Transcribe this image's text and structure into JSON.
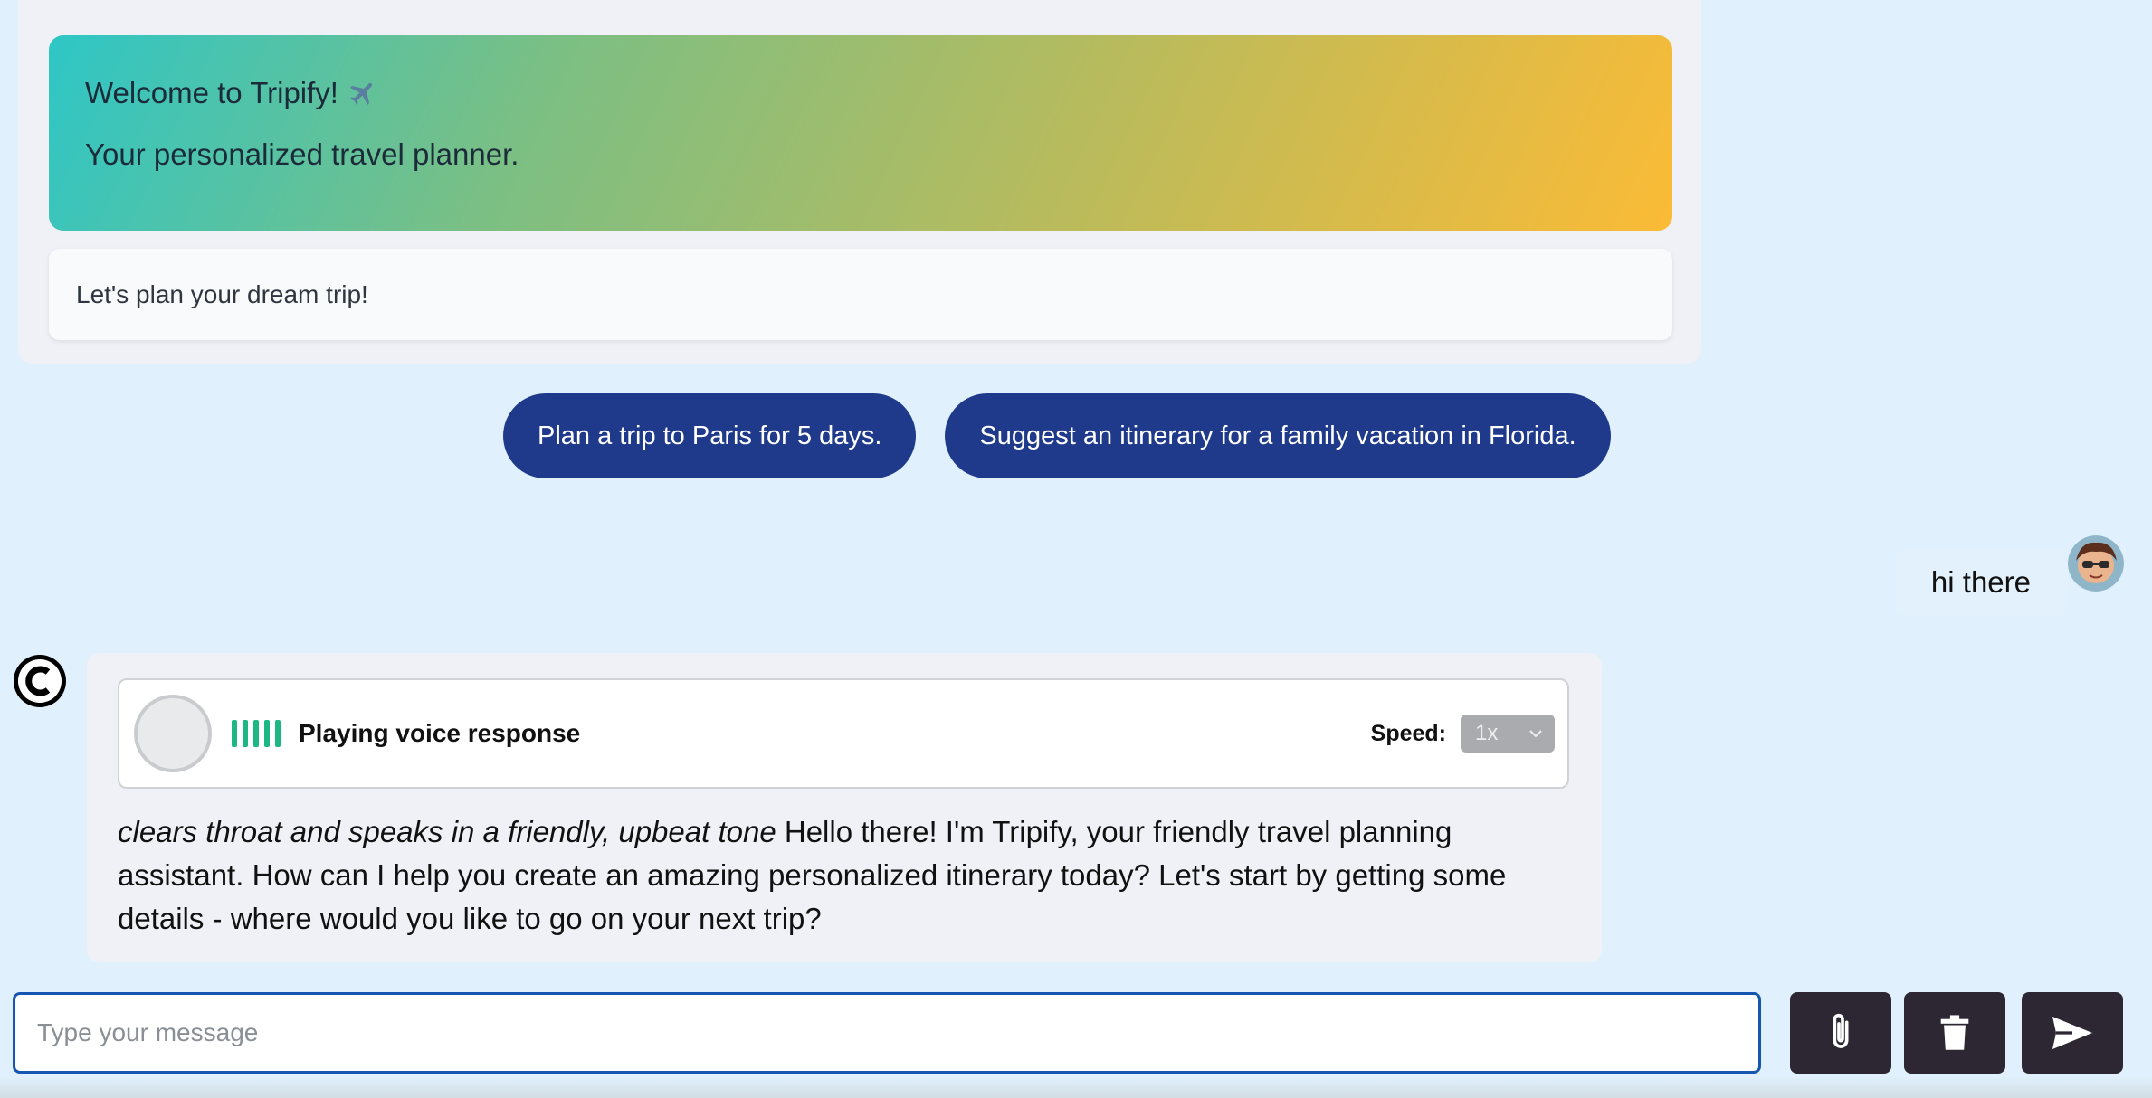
{
  "welcome": {
    "title": "Welcome to Tripify!",
    "subtitle": "Your personalized travel planner.",
    "note": "Let's plan your dream trip!"
  },
  "suggestions": [
    "Plan a trip to Paris for 5 days.",
    "Suggest an itinerary for a family vacation in Florida."
  ],
  "user_message": {
    "text": "hi there"
  },
  "bot_message": {
    "voice": {
      "status": "Playing voice response",
      "speed_label": "Speed:",
      "speed_value": "1x"
    },
    "stage_direction": "clears throat and speaks in a friendly, upbeat tone",
    "text": " Hello there! I'm Tripify, your friendly travel planning assistant. How can I help you create an amazing personalized itinerary today? Let's start by getting some details - where would you like to go on your next trip?"
  },
  "input": {
    "placeholder": "Type your message",
    "value": ""
  },
  "icons": {
    "attach": "paperclip-icon",
    "delete": "trash-icon",
    "send": "send-icon"
  },
  "colors": {
    "chip": "#1f3a8a",
    "voice_wave": "#1db784",
    "action_button": "#2d2633",
    "input_border": "#1557b0"
  }
}
